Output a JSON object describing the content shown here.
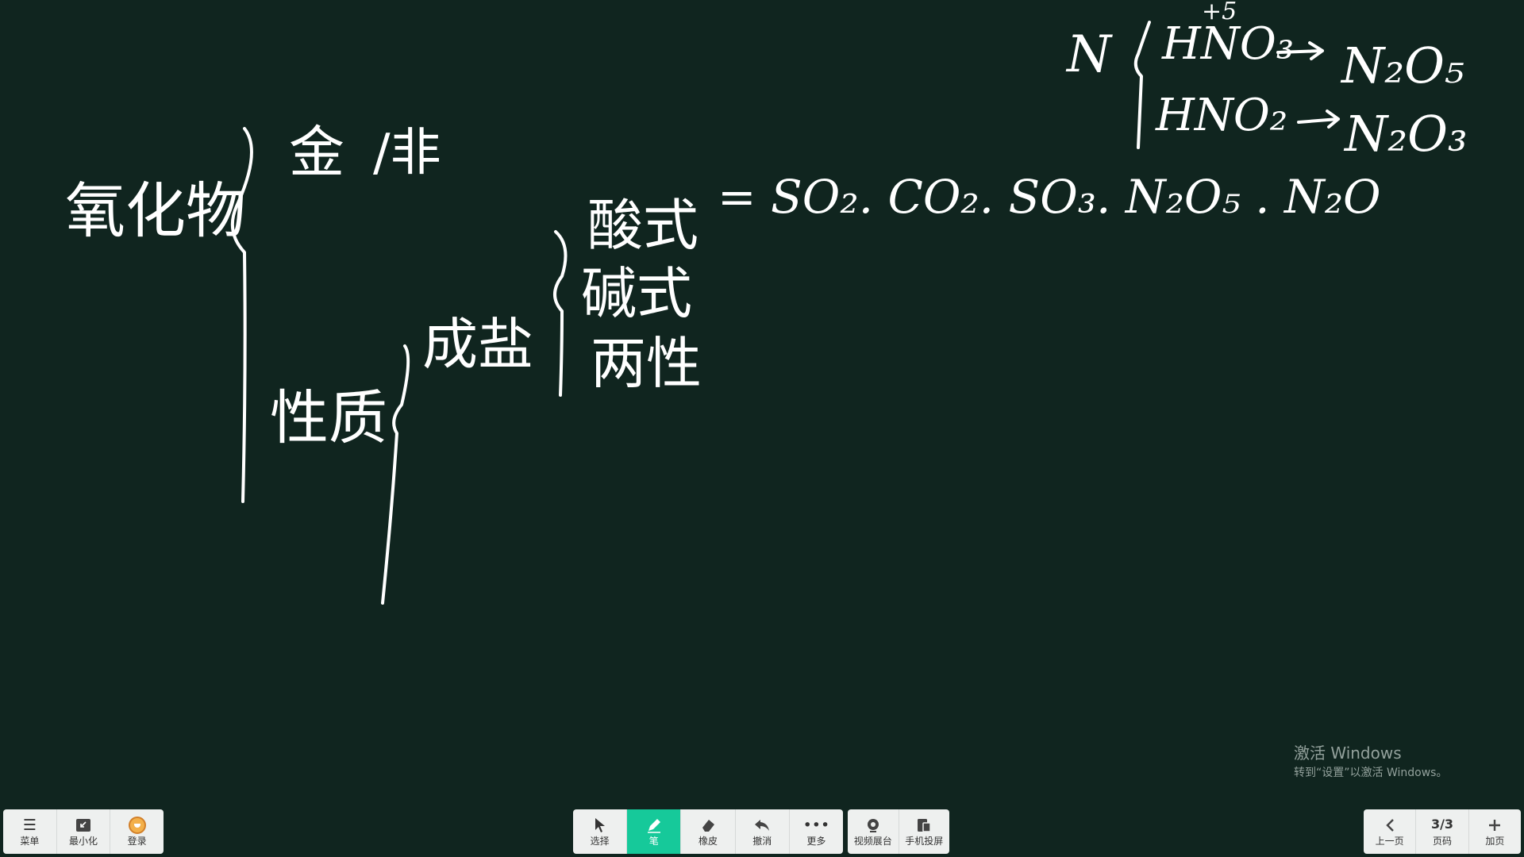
{
  "board": {
    "root_label": "氧化物",
    "branch_metal": "金",
    "branch_nonmetal": "/非",
    "branch_property": "性质",
    "salt_label": "成盐",
    "acidic_label": "酸式",
    "basic_label": "碱式",
    "amphoteric_label": "两性",
    "acidic_examples": "= SO₂. CO₂. SO₃. N₂O₅ . N₂O",
    "nitrogen_label": "N",
    "n_acid1": "HNO₃",
    "n_oxide1": "N₂O₅",
    "n_acid2": "HNO₂",
    "n_oxide2": "N₂O₃",
    "ox_mark": "+5"
  },
  "toolbar_left": {
    "menu": "菜单",
    "minimize": "最小化",
    "login": "登录"
  },
  "toolbar_tools": {
    "select": "选择",
    "pen": "笔",
    "eraser": "橡皮",
    "undo": "撤消",
    "more": "更多"
  },
  "toolbar_media": {
    "video_booth": "视频展台",
    "phone_cast": "手机投屏"
  },
  "toolbar_page": {
    "prev": "上一页",
    "page_indicator": "3/3",
    "page_label": "页码",
    "add_page": "加页"
  },
  "watermark": {
    "line1": "激活 Windows",
    "line2": "转到“设置”以激活 Windows。"
  },
  "icons": {
    "menu": "menu-icon",
    "minimize": "minimize-icon",
    "login": "avatar-icon",
    "select": "cursor-icon",
    "pen": "pen-icon",
    "eraser": "eraser-icon",
    "undo": "undo-icon",
    "more": "more-icon",
    "video_booth": "camera-icon",
    "phone_cast": "phone-cast-icon",
    "prev": "chevron-left-icon",
    "add": "plus-icon"
  },
  "colors": {
    "board_bg": "#10251f",
    "ink": "#ffffff",
    "toolbar_bg": "#eef0ef",
    "active_tool": "#16c99a"
  }
}
